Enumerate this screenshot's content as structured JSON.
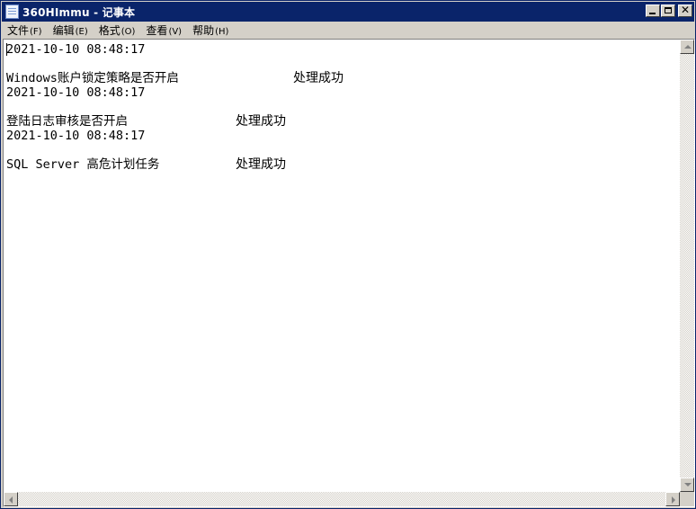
{
  "window": {
    "title": "360HImmu - 记事本"
  },
  "menu": {
    "items": [
      {
        "label": "文件",
        "accel": "(F)"
      },
      {
        "label": "编辑",
        "accel": "(E)"
      },
      {
        "label": "格式",
        "accel": "(O)"
      },
      {
        "label": "查看",
        "accel": "(V)"
      },
      {
        "label": "帮助",
        "accel": "(H)"
      }
    ]
  },
  "document": {
    "entries": [
      {
        "timestamp": "2021-10-10 08:48:17",
        "task": "Windows账户锁定策略是否开启",
        "status": "处理成功"
      },
      {
        "timestamp": "2021-10-10 08:48:17",
        "task": "登陆日志审核是否开启",
        "status": "处理成功"
      },
      {
        "timestamp": "2021-10-10 08:48:17",
        "task": "SQL Server 高危计划任务",
        "status": "处理成功"
      }
    ]
  }
}
